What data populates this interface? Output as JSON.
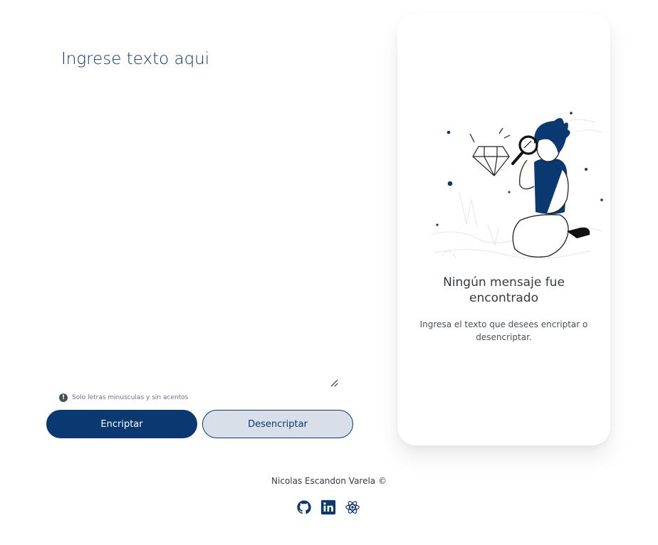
{
  "input": {
    "placeholder": "Ingrese texto aqui",
    "value": ""
  },
  "hint": {
    "icon": "exclamation-circle-icon",
    "text": "Solo letras minusculas y sin acentos"
  },
  "buttons": {
    "encrypt_label": "Encriptar",
    "decrypt_label": "Desencriptar"
  },
  "output": {
    "illustration": "person-with-magnifying-glass-illustration",
    "title": "Ningún mensaje fue encontrado",
    "description": "Ingresa el texto que desees encriptar o desencriptar."
  },
  "footer": {
    "credit": "Nicolas Escandon Varela ©",
    "links": [
      {
        "icon": "github-icon"
      },
      {
        "icon": "linkedin-icon"
      },
      {
        "icon": "react-icon"
      }
    ]
  },
  "colors": {
    "primary": "#0a3871",
    "secondary_button_bg": "#d8dfe8",
    "text_dark": "#343a40",
    "text_muted": "#495057"
  }
}
